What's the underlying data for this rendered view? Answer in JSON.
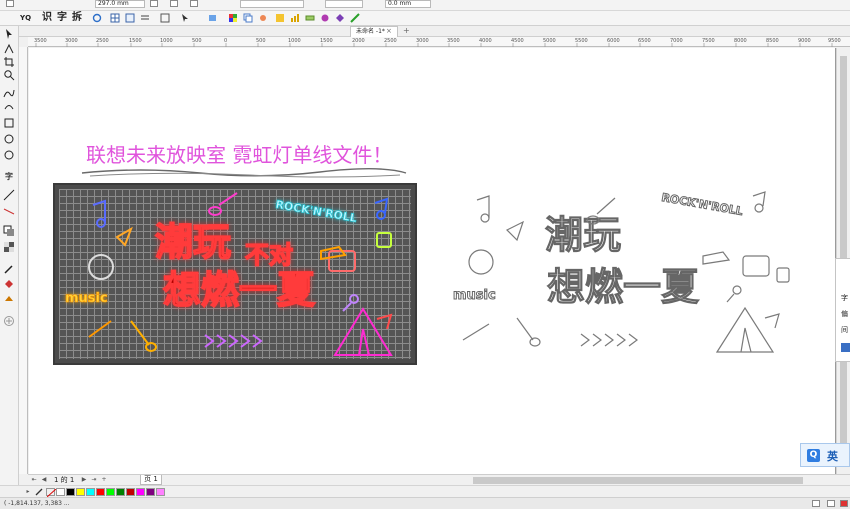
{
  "propbar": {
    "width_value": "297.0 mm",
    "offset_value": "0.0 mm"
  },
  "toolbar": {
    "items": [
      "识",
      "字",
      "拆"
    ]
  },
  "document": {
    "tab_title": "未命名 -1*",
    "close_glyph": "×",
    "add_glyph": "+"
  },
  "ruler": {
    "labels": [
      "3500",
      "3000",
      "2500",
      "1500",
      "1000",
      "500",
      "0",
      "500",
      "1000",
      "1500",
      "2000",
      "2500",
      "3000",
      "3500",
      "4000",
      "4500",
      "5000",
      "5500",
      "6000",
      "6500",
      "7000",
      "7500",
      "8000",
      "8500",
      "9000",
      "9500"
    ]
  },
  "toolbox": {
    "text_tool": "字"
  },
  "artwork": {
    "headline": "联想未来放映室 霓虹灯单线文件！",
    "main_text_line1": "潮玩",
    "main_text_line2": "想燃一夏",
    "main_text_small": "不对",
    "rock_sign": "ROCK'N'ROLL",
    "music_sign": "music",
    "outline_main_line1": "潮玩",
    "outline_main_line2": "想燃一夏",
    "outline_rock_sign": "ROCK'N'ROLL",
    "outline_music_sign": "music"
  },
  "pagenav": {
    "page_count": "1 的 1",
    "page_tab": "页 1"
  },
  "palette": {
    "colors": [
      "#ffffff",
      "#000000",
      "#ffff00",
      "#00ffff",
      "#ff0000",
      "#00ff00",
      "#008000",
      "#c00000",
      "#ff00ff",
      "#800080",
      "#ff80ff"
    ]
  },
  "status": {
    "coords": "( -1,814.137, 3,383 ..."
  },
  "docker": {
    "items": [
      "字",
      "偏",
      "间"
    ]
  },
  "ime": {
    "badge": "Q",
    "label": "英"
  }
}
